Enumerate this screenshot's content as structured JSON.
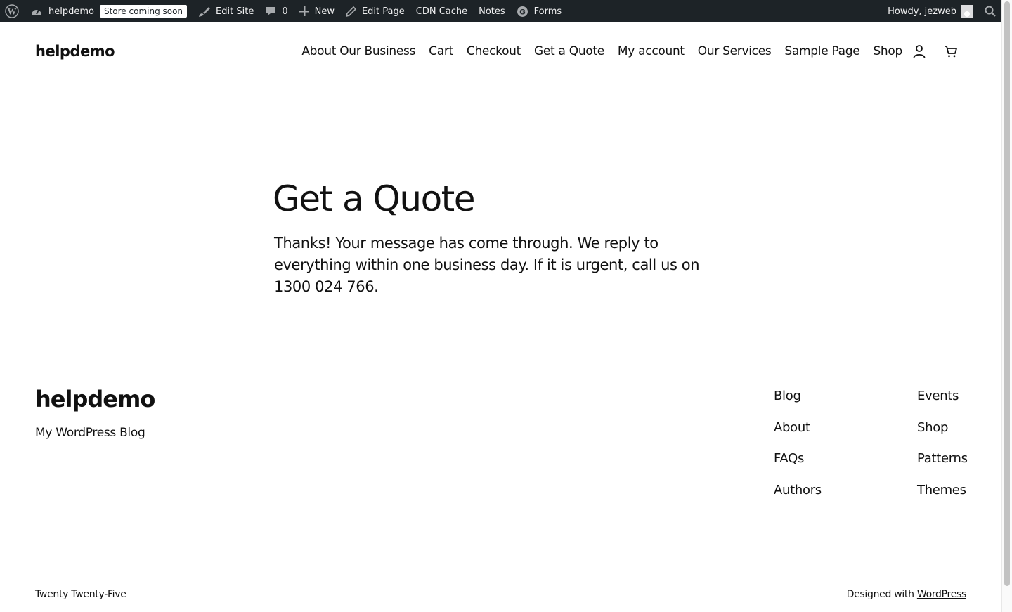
{
  "admin_bar": {
    "site_name": "helpdemo",
    "store_badge": "Store coming soon",
    "edit_site": "Edit Site",
    "comments_count": "0",
    "new": "New",
    "edit_page": "Edit Page",
    "cdn_cache": "CDN Cache",
    "notes": "Notes",
    "forms": "Forms",
    "howdy": "Howdy, jezweb"
  },
  "header": {
    "site_title": "helpdemo",
    "nav": [
      "About Our Business",
      "Cart",
      "Checkout",
      "Get a Quote",
      "My account",
      "Our Services",
      "Sample Page",
      "Shop"
    ]
  },
  "main": {
    "title": "Get a Quote",
    "message": "Thanks! Your message has come through. We reply to everything within one business day. If it is urgent, call us on 1300 024 766."
  },
  "footer": {
    "site_title": "helpdemo",
    "tagline": "My WordPress Blog",
    "col1": [
      "Blog",
      "About",
      "FAQs",
      "Authors"
    ],
    "col2": [
      "Events",
      "Shop",
      "Patterns",
      "Themes"
    ],
    "theme_name": "Twenty Twenty-Five",
    "designed_with": "Designed with",
    "wordpress_link": "WordPress"
  },
  "colors": {
    "admin_bar_bg": "#1d2327",
    "admin_bar_text": "#f0f0f1",
    "text": "#111111",
    "background": "#ffffff"
  },
  "icons": [
    "wordpress-icon",
    "dashboard-icon",
    "brush-icon",
    "comment-icon",
    "plus-icon",
    "pencil-icon",
    "forms-icon",
    "search-icon",
    "account-icon",
    "cart-icon"
  ]
}
